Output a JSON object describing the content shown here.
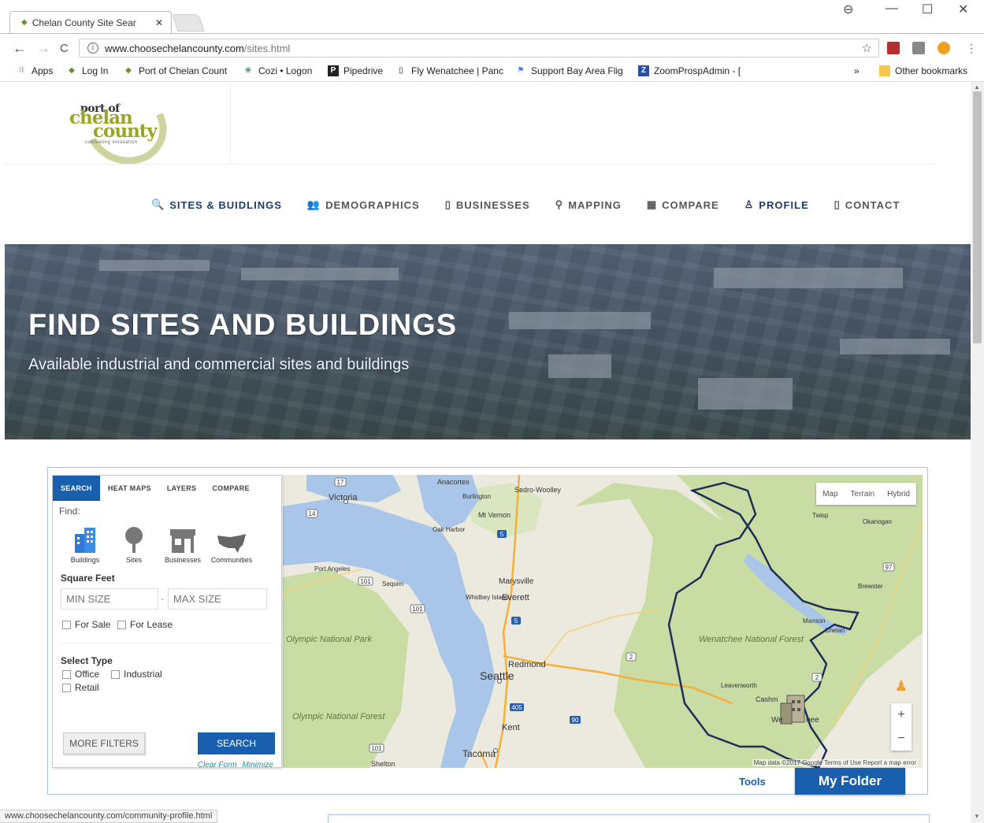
{
  "browser": {
    "tab_title": "Chelan County Site Sear",
    "tab_close": "✕",
    "url_host": "www.choosechelancounty.com",
    "url_path": "/sites.html",
    "win_controls": [
      "—",
      "☐",
      "✕"
    ],
    "nav_icons": {
      "back": "←",
      "forward": "→",
      "reload": "C"
    },
    "bookmarks": [
      {
        "label": "Apps",
        "icon": "apps-icon"
      },
      {
        "label": "Log In",
        "icon": "port-logo-icon"
      },
      {
        "label": "Port of Chelan Count",
        "icon": "port-logo-icon"
      },
      {
        "label": "Cozi • Logon",
        "icon": "cozi-icon"
      },
      {
        "label": "Pipedrive",
        "icon": "pipedrive-icon"
      },
      {
        "label": "Fly Wenatchee | Panc",
        "icon": "page-icon"
      },
      {
        "label": "Support Bay Area Flig",
        "icon": "flag-icon"
      },
      {
        "label": "ZoomProspAdmin - [",
        "icon": "zoom-icon"
      }
    ],
    "bookmarks_more": "»",
    "other_bookmarks": "Other bookmarks",
    "status_url": "www.choosechelancounty.com/community-profile.html"
  },
  "logo": {
    "line1": "port of",
    "line2": "chelan",
    "line3": "county",
    "tagline": "cultivating innovation"
  },
  "nav": [
    {
      "label": "SITES & BUIDLINGS",
      "icon": "search-icon",
      "glyph": "🔍"
    },
    {
      "label": "DEMOGRAPHICS",
      "icon": "users-icon",
      "glyph": "👥"
    },
    {
      "label": "BUSINESSES",
      "icon": "building-icon",
      "glyph": "▯"
    },
    {
      "label": "MAPPING",
      "icon": "map-marker-icon",
      "glyph": "⚲"
    },
    {
      "label": "COMPARE",
      "icon": "chart-icon",
      "glyph": "▦"
    },
    {
      "label": "PROFILE",
      "icon": "sitemap-icon",
      "glyph": "♙"
    },
    {
      "label": "CONTACT",
      "icon": "phone-icon",
      "glyph": "▯"
    }
  ],
  "hero": {
    "title": "FIND SITES AND BUILDINGS",
    "subtitle": "Available industrial and commercial sites and buildings"
  },
  "search_panel": {
    "tabs": [
      "SEARCH",
      "HEAT MAPS",
      "LAYERS",
      "COMPARE"
    ],
    "find_label": "Find:",
    "types": [
      "Buildings",
      "Sites",
      "Businesses",
      "Communities"
    ],
    "sqft_label": "Square Feet",
    "min_placeholder": "MIN SIZE",
    "max_placeholder": "MAX SIZE",
    "dash": "-",
    "for_sale": "For Sale",
    "for_lease": "For Lease",
    "select_type": "Select Type",
    "office": "Office",
    "industrial": "Industrial",
    "retail": "Retail",
    "more_filters": "MORE FILTERS",
    "search_btn": "SEARCH",
    "clear_form": "Clear Form",
    "minimize": "Minimize"
  },
  "map": {
    "types": [
      "Map",
      "Terrain",
      "Hybrid"
    ],
    "zoom_in": "+",
    "zoom_out": "−",
    "attribution": "Map data ©2017 Google  Terms of Use  Report a map error",
    "labels": [
      {
        "text": "Victoria"
      },
      {
        "text": "Anacortes"
      },
      {
        "text": "Sedro-Woolley"
      },
      {
        "text": "Burlington"
      },
      {
        "text": "Mt Vernon"
      },
      {
        "text": "Oak Harbor"
      },
      {
        "text": "Port Angeles"
      },
      {
        "text": "Sequim"
      },
      {
        "text": "Marysville"
      },
      {
        "text": "Whidbey Island"
      },
      {
        "text": "Everett"
      },
      {
        "text": "Olympic National Park"
      },
      {
        "text": "Redmond"
      },
      {
        "text": "Seattle"
      },
      {
        "text": "Kent"
      },
      {
        "text": "Tacoma"
      },
      {
        "text": "Shelton"
      },
      {
        "text": "Olympic National Forest"
      },
      {
        "text": "Wenatchee National Forest"
      },
      {
        "text": "Leavenworth"
      },
      {
        "text": "Cashm"
      },
      {
        "text": "We"
      },
      {
        "text": "hee"
      },
      {
        "text": "Manson"
      },
      {
        "text": "Chelan"
      },
      {
        "text": "Twisp"
      },
      {
        "text": "Okanogan"
      },
      {
        "text": "Brewster"
      }
    ],
    "shields": [
      "17",
      "14",
      "5",
      "101",
      "101",
      "5",
      "2",
      "2",
      "97",
      "405",
      "90",
      "101"
    ]
  },
  "tools_label": "Tools",
  "my_folder_label": "My Folder",
  "colors": {
    "brand_blue": "#1a5fae",
    "nav_active": "#1f3c66",
    "logo_green": "#9aa526",
    "forest": "#c8dca4",
    "water": "#a9c6e8"
  }
}
